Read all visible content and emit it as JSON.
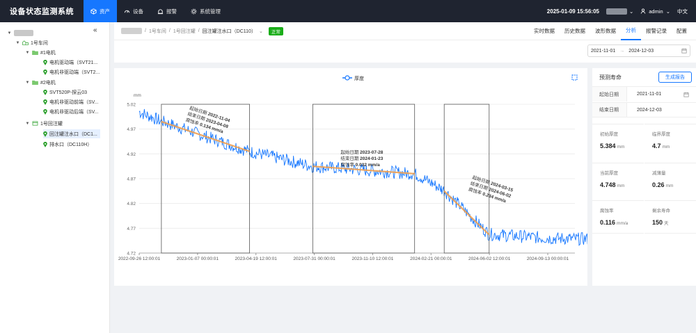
{
  "app": {
    "title": "设备状态监测系统"
  },
  "nav": [
    {
      "label": "资产",
      "icon": "cube-icon"
    },
    {
      "label": "设备",
      "icon": "gauge-icon"
    },
    {
      "label": "报警",
      "icon": "alarm-icon"
    },
    {
      "label": "系统管理",
      "icon": "gear-icon"
    }
  ],
  "topbar": {
    "datetime": "2025-01-09 15:56:05",
    "user": "admin",
    "lang": "中文"
  },
  "tree": {
    "workshop": "1号车间",
    "motor1": "#1电机",
    "motor1_items": [
      "电机驱动端（SVT21...",
      "电机非驱动端（SVT2..."
    ],
    "motor2": "#2电机",
    "motor2_items": [
      "SVT520P-探云03",
      "电机非驱动前端（SV...",
      "电机非驱动后端（SV..."
    ],
    "tank": "1号回注罐",
    "tank_items": [
      "回注罐注水口（DC1...",
      "排水口（DC110H）"
    ]
  },
  "breadcrumb": {
    "items": [
      "1号车间",
      "1号回注罐",
      "回注罐注水口（DC110）"
    ],
    "status": "正常"
  },
  "tabs": [
    "实时数据",
    "历史数据",
    "波形数据",
    "分析",
    "报警记录",
    "配置"
  ],
  "active_tab": "分析",
  "daterange": {
    "start": "2021-11-01",
    "end": "2024-12-03",
    "sep": "→"
  },
  "panel": {
    "title": "预测寿命",
    "report_button": "生成报告",
    "start_label": "起始日期",
    "start_value": "2021-11-01",
    "end_label": "结束日期",
    "end_value": "2024-12-03",
    "initial_label": "初始厚度",
    "initial_value": "5.384",
    "initial_unit": "mm",
    "critical_label": "临界厚度",
    "critical_value": "4.7",
    "critical_unit": "mm",
    "current_label": "当前厚度",
    "current_value": "4.748",
    "current_unit": "mm",
    "reduction_label": "减薄量",
    "reduction_value": "0.26",
    "reduction_unit": "mm",
    "corrosion_label": "腐蚀率",
    "corrosion_value": "0.116",
    "corrosion_unit": "mm/a",
    "remaining_label": "剩余寿命",
    "remaining_value": "150",
    "remaining_unit": "天"
  },
  "chart_data": {
    "type": "line",
    "legend": "厚度",
    "legend_position": "top-center",
    "yunit": "mm",
    "ylim": [
      4.72,
      5.02
    ],
    "yticks": [
      5.02,
      4.97,
      4.92,
      4.87,
      4.82,
      4.77,
      4.72
    ],
    "xticks": [
      "2022-09-26 12:00:01",
      "2023-01-07 00:00:01",
      "2023-04-19 12:00:01",
      "2023-07-31 00:00:01",
      "2023-11-10 12:00:01",
      "2024-02-21 00:00:01",
      "2024-06-02 12:00:01",
      "2024-09-13 00:00:01"
    ],
    "grid": true,
    "series": [
      {
        "name": "厚度",
        "x": [
          "2022-09-26",
          "2022-11-04",
          "2023-04-08",
          "2023-07-28",
          "2024-01-23",
          "2024-03-15",
          "2024-06-02",
          "2024-09-13",
          "2024-12-03"
        ],
        "values": [
          5.005,
          4.986,
          4.925,
          4.895,
          4.88,
          4.847,
          4.758,
          4.75,
          4.748
        ]
      }
    ],
    "fits": [
      {
        "start": "2022-11-04",
        "end": "2023-04-08",
        "rate": "0.134",
        "y0": 4.985,
        "y1": 4.925,
        "start_label": "起始日期",
        "end_label": "结束日期",
        "rate_label": "腐蚀率",
        "rate_unit": "mm/a"
      },
      {
        "start": "2023-07-28",
        "end": "2024-01-23",
        "rate": "0.032",
        "y0": 4.895,
        "y1": 4.88,
        "start_label": "起始日期",
        "end_label": "结束日期",
        "rate_label": "腐蚀率",
        "rate_unit": "mm/a"
      },
      {
        "start": "2024-03-15",
        "end": "2024-06-02",
        "rate": "0.234",
        "y0": 4.845,
        "y1": 4.757,
        "start_label": "起始日期",
        "end_label": "结束日期",
        "rate_label": "腐蚀率",
        "rate_unit": "mm/a"
      }
    ],
    "colors": {
      "line": "#1677ff",
      "fit": "#f0a050",
      "window": "#555555"
    }
  }
}
